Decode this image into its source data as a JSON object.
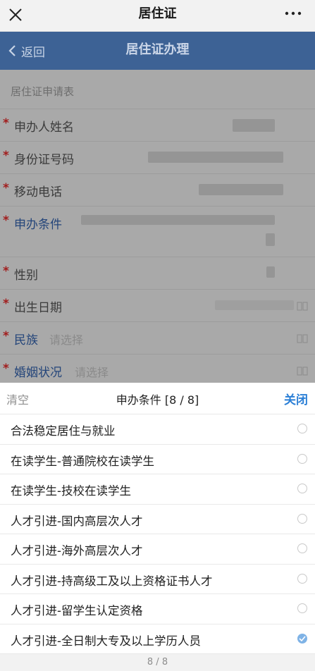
{
  "topbar": {
    "title": "居住证",
    "close_icon": "close-icon",
    "more_icon": "more-icon"
  },
  "navbar": {
    "back_label": "返回",
    "title": "居住证办理"
  },
  "form": {
    "section_title": "居住证申请表",
    "required_mark": "*",
    "fields": [
      {
        "label": "申办人姓名"
      },
      {
        "label": "身份证号码"
      },
      {
        "label": "移动电话"
      },
      {
        "label": "申办条件"
      },
      {
        "label": "性别"
      },
      {
        "label": "出生日期"
      },
      {
        "label": "民族",
        "placeholder": "请选择"
      },
      {
        "label": "婚姻状况",
        "placeholder": "请选择"
      }
    ]
  },
  "sheet": {
    "clear_label": "清空",
    "title": "申办条件 [8 / 8]",
    "close_label": "关闭",
    "options": [
      {
        "label": "合法稳定居住与就业",
        "selected": false
      },
      {
        "label": "在读学生-普通院校在读学生",
        "selected": false
      },
      {
        "label": "在读学生-技校在读学生",
        "selected": false
      },
      {
        "label": "人才引进-国内高层次人才",
        "selected": false
      },
      {
        "label": "人才引进-海外高层次人才",
        "selected": false
      },
      {
        "label": "人才引进-持高级工及以上资格证书人才",
        "selected": false
      },
      {
        "label": "人才引进-留学生认定资格",
        "selected": false
      },
      {
        "label": "人才引进-全日制大专及以上学历人员",
        "selected": true
      }
    ],
    "pager": "8 / 8"
  },
  "colors": {
    "accent": "#2b7fd6",
    "navbar": "#3d6295",
    "required": "#a11d1d"
  }
}
